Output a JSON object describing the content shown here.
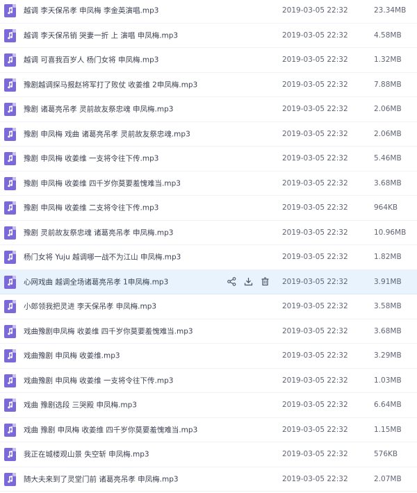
{
  "colors": {
    "file_icon": "#7b68d9",
    "highlight_row": "#e8f3fd",
    "text": "#3c4152",
    "meta_text": "#5f6474"
  },
  "files": [
    {
      "name": "越调 李天保吊孝 申凤梅 李金英演唱.mp3",
      "date": "2019-03-05 22:32",
      "size": "23.34MB"
    },
    {
      "name": "越调 李天保吊销 哭妻一折 上 演唱 申凤梅.mp3",
      "date": "2019-03-05 22:32",
      "size": "4.58MB"
    },
    {
      "name": "越调 可喜我百岁人 杨门女将 申凤梅.mp3",
      "date": "2019-03-05 22:32",
      "size": "1.32MB"
    },
    {
      "name": "豫剧越调探马报赵将军打了败仗 收姜维 2申凤梅.mp3",
      "date": "2019-03-05 22:32",
      "size": "7.88MB"
    },
    {
      "name": "豫剧 诸葛亮吊孝 灵前故友祭忠魂 申凤梅.mp3",
      "date": "2019-03-05 22:32",
      "size": "2.06MB"
    },
    {
      "name": "豫剧 申凤梅 戏曲 诸葛亮吊孝 灵前故友祭忠魂.mp3",
      "date": "2019-03-05 22:32",
      "size": "2.06MB"
    },
    {
      "name": "豫剧 申凤梅 收姜维 一支将令往下传.mp3",
      "date": "2019-03-05 22:32",
      "size": "5.46MB"
    },
    {
      "name": "豫剧 申凤梅 收姜维 四千岁你莫要羞愧难当.mp3",
      "date": "2019-03-05 22:32",
      "size": "3.68MB"
    },
    {
      "name": "豫剧 申凤梅 收姜维 二支将令往下传.mp3",
      "date": "2019-03-05 22:32",
      "size": "964KB"
    },
    {
      "name": "豫剧 灵前故友祭忠魂 诸葛亮吊孝 申凤梅.mp3",
      "date": "2019-03-05 22:32",
      "size": "10.96MB"
    },
    {
      "name": "杨门女将 Yuju 越调哪一战不为江山 申凤梅.mp3",
      "date": "2019-03-05 22:32",
      "size": "1.82MB"
    },
    {
      "name": "心网戏曲 越调全场诸葛亮吊孝 1申凤梅.mp3",
      "date": "2019-03-05 22:32",
      "size": "3.91MB",
      "highlighted": true
    },
    {
      "name": "小郎领我把灵进 李天保吊孝 申凤梅.mp3",
      "date": "2019-03-05 22:32",
      "size": "3.58MB"
    },
    {
      "name": "戏曲豫剧申凤梅 收姜维 四千岁你莫要羞愧难当.mp3",
      "date": "2019-03-05 22:32",
      "size": "3.68MB"
    },
    {
      "name": "戏曲豫剧 申凤梅 收姜维.mp3",
      "date": "2019-03-05 22:32",
      "size": "3.29MB"
    },
    {
      "name": "戏曲豫剧 申凤梅 收姜维 一支将令往下传.mp3",
      "date": "2019-03-05 22:32",
      "size": "1.03MB"
    },
    {
      "name": "戏曲 豫剧选段 三哭殿 申凤梅.mp3",
      "date": "2019-03-05 22:32",
      "size": "6.64MB"
    },
    {
      "name": "戏曲 豫剧 申凤梅 收姜维 四千岁你莫要羞愧难当.mp3",
      "date": "2019-03-05 22:32",
      "size": "1.15MB"
    },
    {
      "name": "我正在城楼观山景 失空斩 申凤梅.mp3",
      "date": "2019-03-05 22:32",
      "size": "576KB"
    },
    {
      "name": "随大夫来到了灵堂门前 诸葛亮吊孝 申凤梅.mp3",
      "date": "2019-03-05 22:32",
      "size": "2.07MB"
    }
  ],
  "row_actions": [
    "share-icon",
    "download-icon",
    "delete-icon"
  ]
}
